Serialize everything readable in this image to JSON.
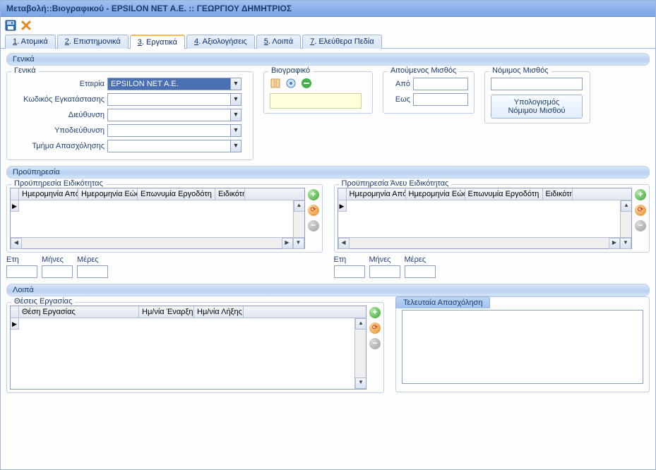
{
  "title": "Μεταβολή::Βιογραφικού - EPSILON NET A.E. :: ΓΕΩΡΓΙΟΥ ΔΗΜΗΤΡΙΟΣ",
  "tabs": [
    {
      "hotkey": "1",
      "label": ". Ατομικά"
    },
    {
      "hotkey": "2",
      "label": ". Επιστημονικά"
    },
    {
      "hotkey": "3",
      "label": ". Εργατικά"
    },
    {
      "hotkey": "4",
      "label": ". Αξιολογήσεις"
    },
    {
      "hotkey": "5",
      "label": ". Λοιπά"
    },
    {
      "hotkey": "7",
      "label": ". Ελεύθερα Πεδία"
    }
  ],
  "active_tab_index": 2,
  "sections": {
    "general": "Γενικά",
    "experience": "Προϋπηρεσία",
    "other": "Λοιπά"
  },
  "general_group": {
    "title": "Γενικά",
    "fields": {
      "company_label": "Εταιρία",
      "company_value": "EPSILON NET A.E.",
      "install_label": "Κωδικός Εγκατάστασης",
      "install_value": "",
      "address_label": "Διεύθυνση",
      "address_value": "",
      "subaddress_label": "Υποδιεύθυνση",
      "subaddress_value": "",
      "dept_label": "Τμήμα Απασχόλησης",
      "dept_value": ""
    }
  },
  "cv_group": {
    "title": "Βιογραφικό",
    "file_value": ""
  },
  "requested_salary": {
    "title": "Αιτούμενος Μισθός",
    "from_label": "Από",
    "from_value": "",
    "to_label": "Εως",
    "to_value": ""
  },
  "legal_salary": {
    "title": "Νόμιμος Μισθός",
    "value": "",
    "button_line1": "Υπολογισμός",
    "button_line2": "Νόμιμου Μισθού"
  },
  "exp_specialty": {
    "title": "Προϋπηρεσία Ειδικότητας",
    "cols": [
      "Ημερομηνία Από",
      "Ημερομηνία Εώς",
      "Επωνυμία Εργοδότη",
      "Ειδικότη"
    ]
  },
  "exp_nospecialty": {
    "title": "Προϋπηρεσία Άνευ Ειδικότητας",
    "cols": [
      "Ημερομηνία Από",
      "Ημερομηνία Εώς",
      "Επωνυμία Εργοδότη",
      "Ειδικότη"
    ]
  },
  "totals": {
    "years": "Ετη",
    "months": "Μήνες",
    "days": "Μέρες",
    "years_v": "",
    "months_v": "",
    "days_v": ""
  },
  "positions": {
    "title": "Θέσεις Εργασίας",
    "cols": [
      "Θέση Εργασίας",
      "Ημ/νία Έναρξης",
      "Ημ/νία Λήξης"
    ]
  },
  "last_employment": {
    "title": "Τελευταία Απασχόληση",
    "value": ""
  }
}
